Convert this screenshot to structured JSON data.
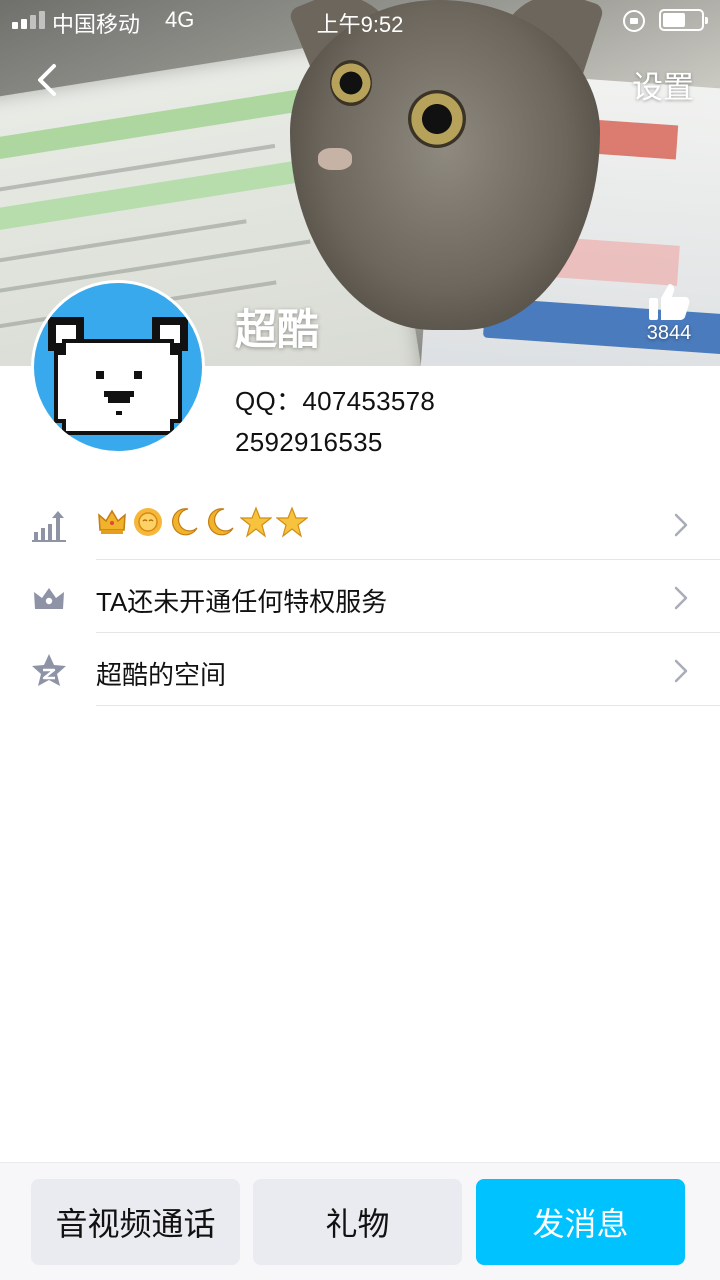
{
  "status_bar": {
    "carrier": "中国移动",
    "network": "4G",
    "time": "上午9:52",
    "battery_level": 0.6
  },
  "nav": {
    "settings_label": "设置"
  },
  "profile": {
    "nickname": "超酷",
    "qq_line": "QQ：407453578",
    "phone_line": "2592916535",
    "like_count": "3844"
  },
  "list": {
    "level_badges": [
      "crown",
      "sun",
      "moon",
      "moon",
      "star",
      "star"
    ],
    "privilege_label": "TA还未开通任何特权服务",
    "space_label": "超酷的空间"
  },
  "bottom_bar": {
    "call_label": "音视频通话",
    "gift_label": "礼物",
    "message_label": "发消息"
  },
  "colors": {
    "accent": "#00c2ff",
    "avatar_bg": "#37a9ec",
    "badge_gold": "#f2b32c",
    "icon_gray": "#8e93a6"
  }
}
